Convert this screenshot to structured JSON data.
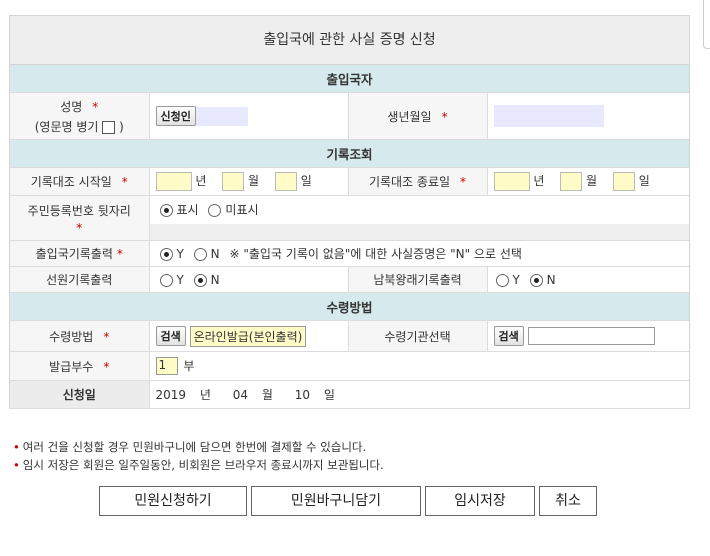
{
  "form": {
    "title": "출입국에 관한 사실 증명 신청",
    "sections": {
      "applicant": "출입국자",
      "record": "기록조회",
      "receipt": "수령방법"
    },
    "required_mark": "*",
    "name": {
      "label": "성명",
      "sublabel_pre": "(영문명 병기",
      "sublabel_post": ")",
      "applicant_button": "신청인"
    },
    "birth": {
      "label": "생년월일"
    },
    "start": {
      "label": "기록대조 시작일",
      "year_unit": "년",
      "month_unit": "월",
      "day_unit": "일"
    },
    "end": {
      "label": "기록대조 종료일",
      "year_unit": "년",
      "month_unit": "월",
      "day_unit": "일"
    },
    "resident": {
      "label": "주민등록번호 뒷자리",
      "opt_show": "표시",
      "opt_hide": "미표시"
    },
    "record_print": {
      "label": "출입국기록출력",
      "opt_y": "Y",
      "opt_n": "N",
      "note": "※ \"출입국 기록이 없음\"에 대한 사실증명은 \"N\" 으로 선택"
    },
    "crew_print": {
      "label": "선원기록출력",
      "opt_y": "Y",
      "opt_n": "N"
    },
    "nk_print": {
      "label": "남북왕래기록출력",
      "opt_y": "Y",
      "opt_n": "N"
    },
    "receipt_method": {
      "label": "수령방법",
      "search_button": "검색",
      "value": "온라인발급(본인출력)"
    },
    "receipt_org": {
      "label": "수령기관선택",
      "search_button": "검색",
      "value": ""
    },
    "copies": {
      "label": "발급부수",
      "value": "1",
      "unit": "부"
    },
    "apply_date": {
      "label": "신청일",
      "year": "2019",
      "year_unit": "년",
      "month": "04",
      "month_unit": "월",
      "day": "10",
      "day_unit": "일"
    }
  },
  "notes": [
    "여러 건을 신청할 경우 민원바구니에 담으면 한번에 결제할 수 있습니다.",
    "임시 저장은 회원은 일주일동안, 비회원은 브라우저 종료시까지 보관됩니다."
  ],
  "note_bullet": "•",
  "buttons": {
    "apply": "민원신청하기",
    "basket": "민원바구니담기",
    "temp_save": "임시저장",
    "cancel": "취소"
  },
  "colors": {
    "section_bg": "#d6e9ec",
    "yellow_input": "#fffcc8",
    "required": "#cc0000"
  }
}
